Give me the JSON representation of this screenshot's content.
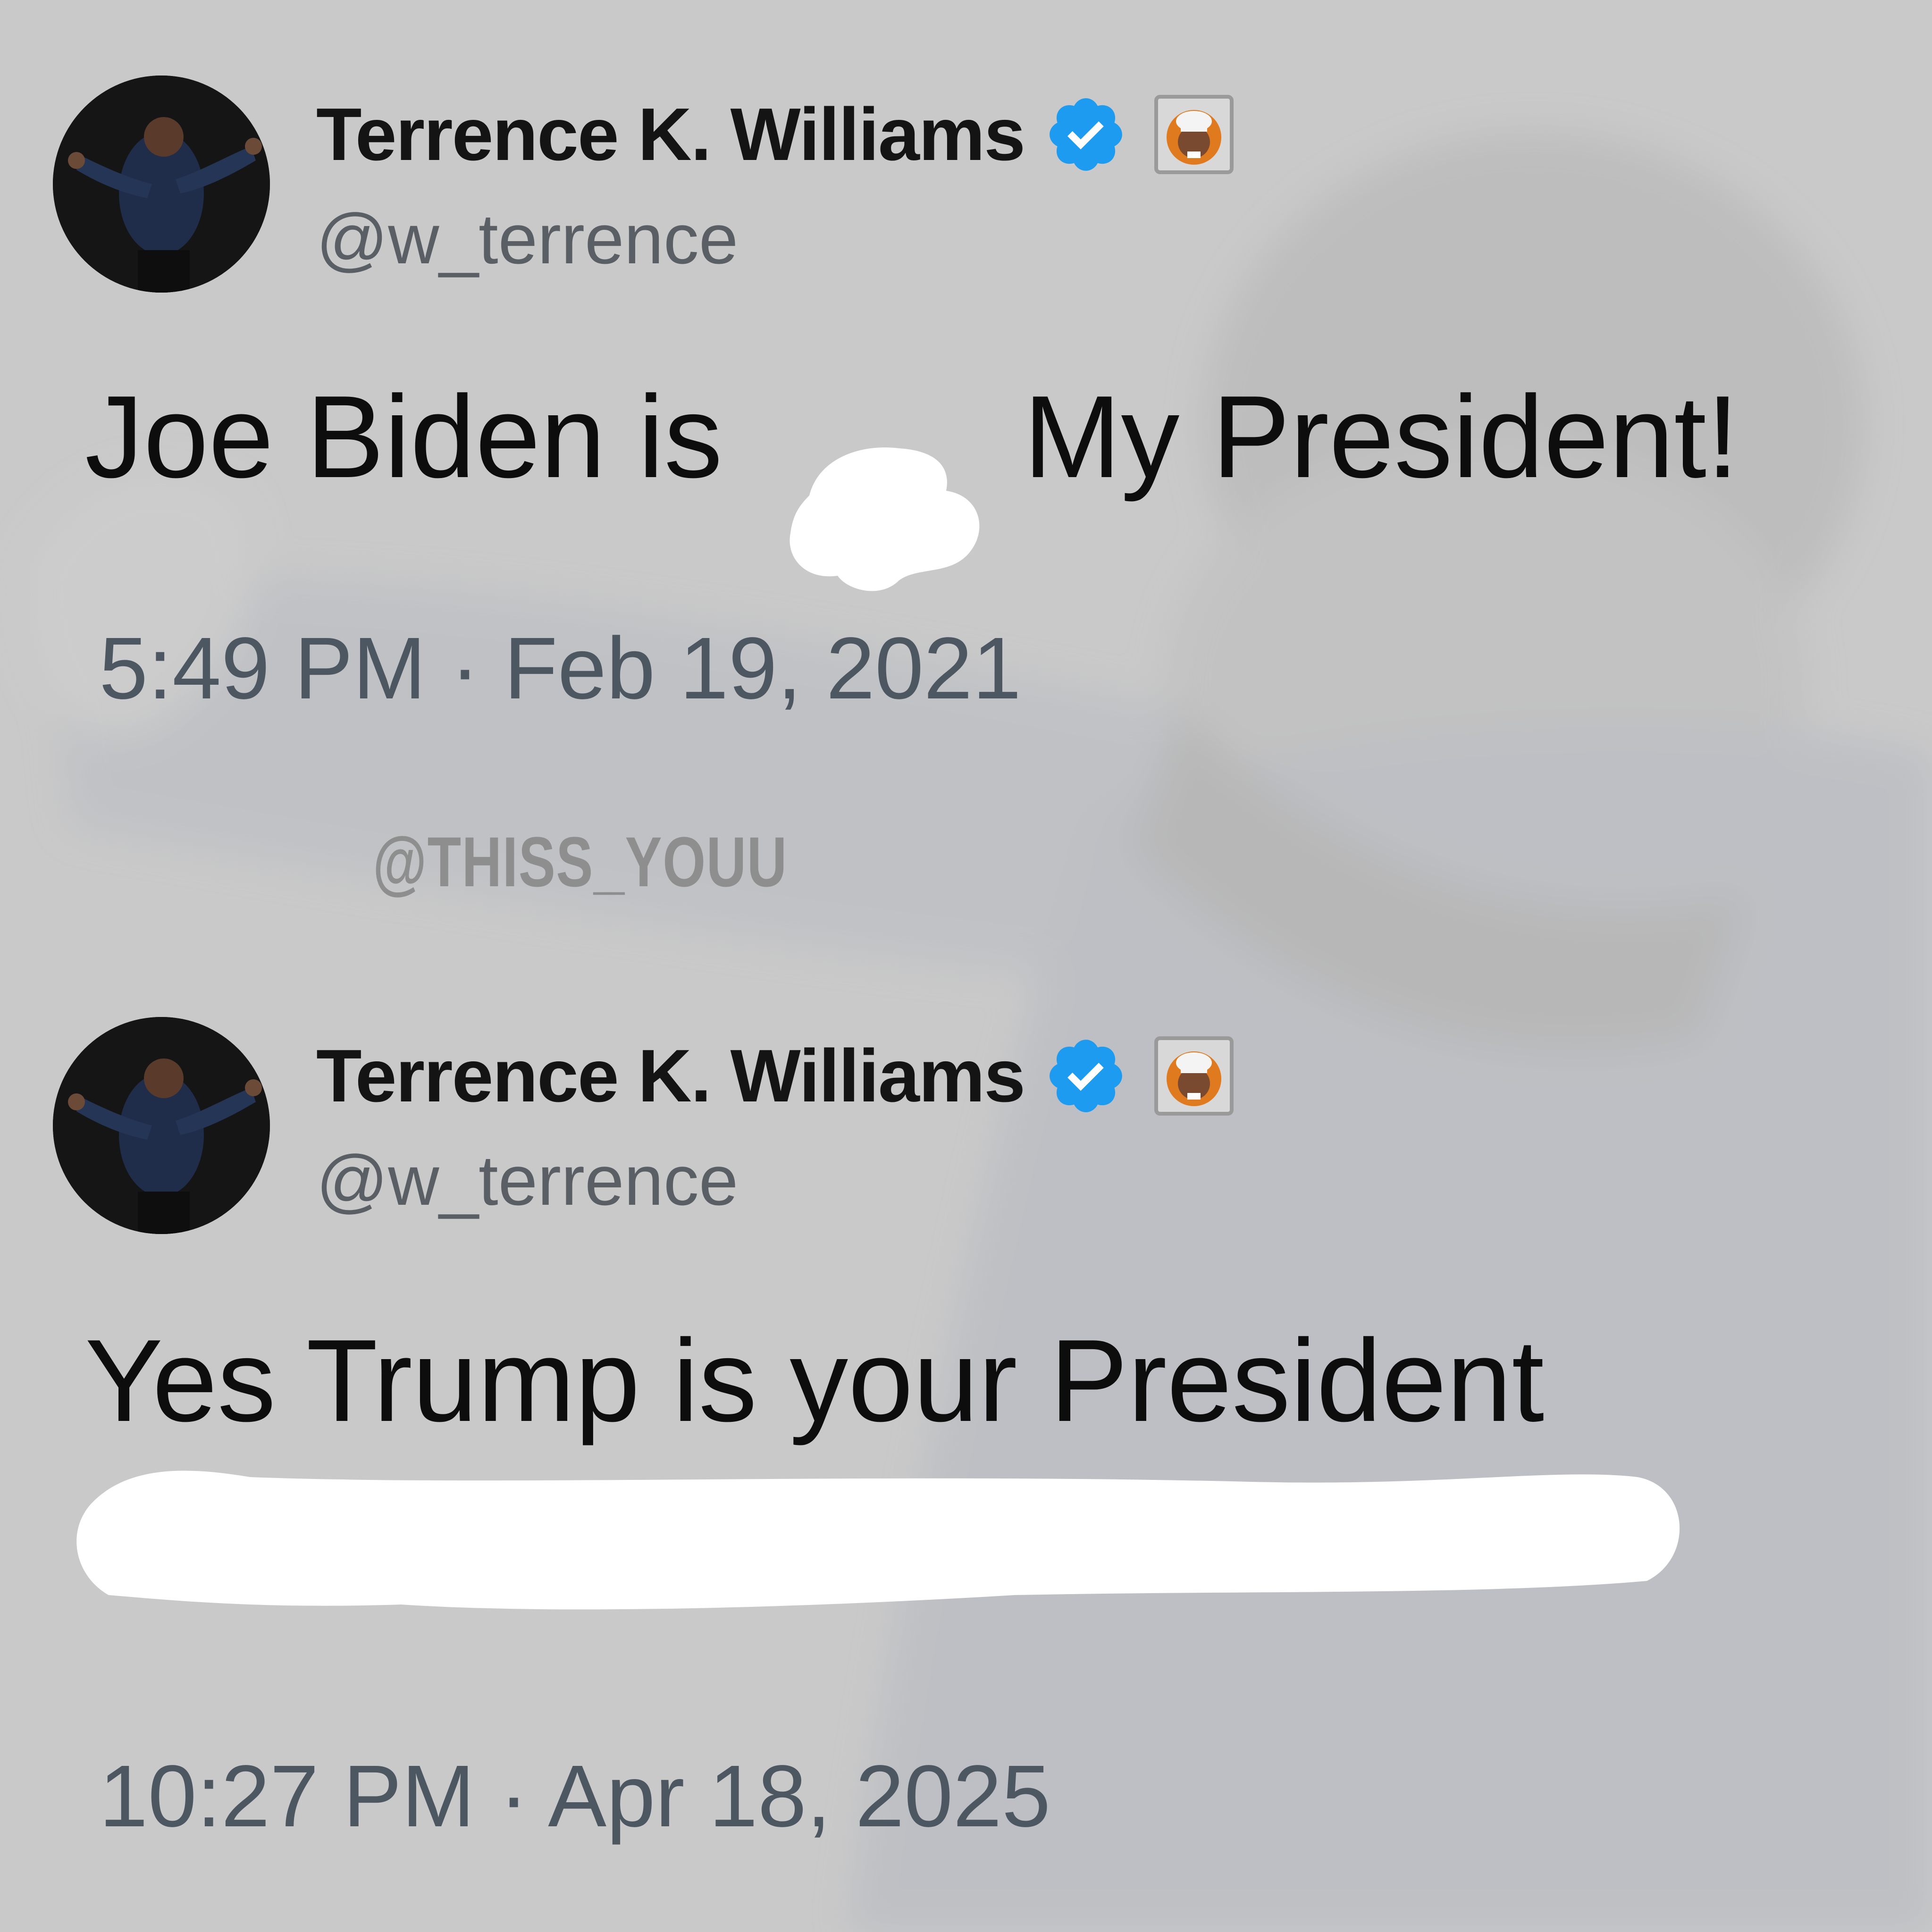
{
  "colors": {
    "background": "#c9c9c9",
    "verified_badge": "#1d9bf0",
    "name_text": "#141414",
    "handle_text": "#5a5f66",
    "timestamp_text": "#4d5761",
    "redaction": "#ffffff"
  },
  "icons": {
    "verified": "verified-badge-icon",
    "affiliation": "affiliate-badge-icon"
  },
  "watermark": "@THISS_YOUU",
  "tweets": [
    {
      "display_name": "Terrence K. Williams",
      "handle": "@w_terrence",
      "text_before_redaction": "Joe Biden is ",
      "text_after_redaction": " My President!",
      "timestamp": "5:49 PM · Feb 19, 2021"
    },
    {
      "display_name": "Terrence K. Williams",
      "handle": "@w_terrence",
      "text": "Yes Trump is your President",
      "timestamp": "10:27 PM · Apr 18, 2025"
    }
  ]
}
